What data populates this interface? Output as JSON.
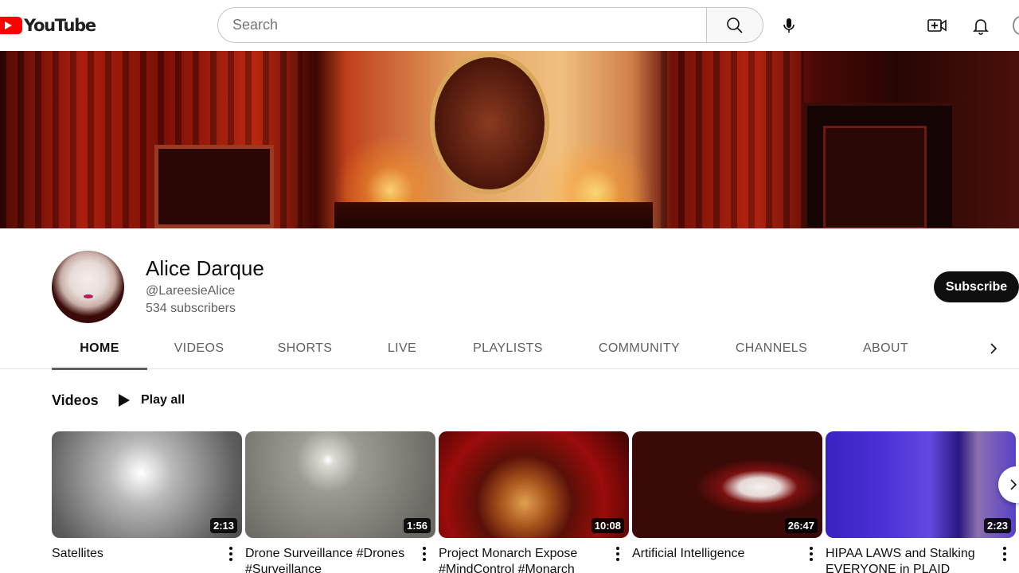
{
  "header": {
    "logo_text": "YouTube",
    "search": {
      "placeholder": "Search",
      "value": ""
    },
    "brand_color": "#ff0000"
  },
  "channel": {
    "name": "Alice Darque",
    "handle": "@LareesieAlice",
    "subscribers": "534 subscribers",
    "subscribe_label": "Subscribe"
  },
  "tabs": [
    {
      "label": "HOME",
      "active": true
    },
    {
      "label": "VIDEOS",
      "active": false
    },
    {
      "label": "SHORTS",
      "active": false
    },
    {
      "label": "LIVE",
      "active": false
    },
    {
      "label": "PLAYLISTS",
      "active": false
    },
    {
      "label": "COMMUNITY",
      "active": false
    },
    {
      "label": "CHANNELS",
      "active": false
    },
    {
      "label": "ABOUT",
      "active": false
    }
  ],
  "section": {
    "title": "Videos",
    "play_all_label": "Play all"
  },
  "videos": [
    {
      "title": "Satellites",
      "duration": "2:13"
    },
    {
      "title": "Drone Surveillance #Drones #Surveillance",
      "duration": "1:56"
    },
    {
      "title": "Project Monarch Expose #MindControl #Monarch",
      "duration": "10:08"
    },
    {
      "title": "Artificial Intelligence",
      "duration": "26:47"
    },
    {
      "title": "HIPAA LAWS and Stalking EVERYONE in PLAID",
      "duration": "2:23"
    }
  ]
}
